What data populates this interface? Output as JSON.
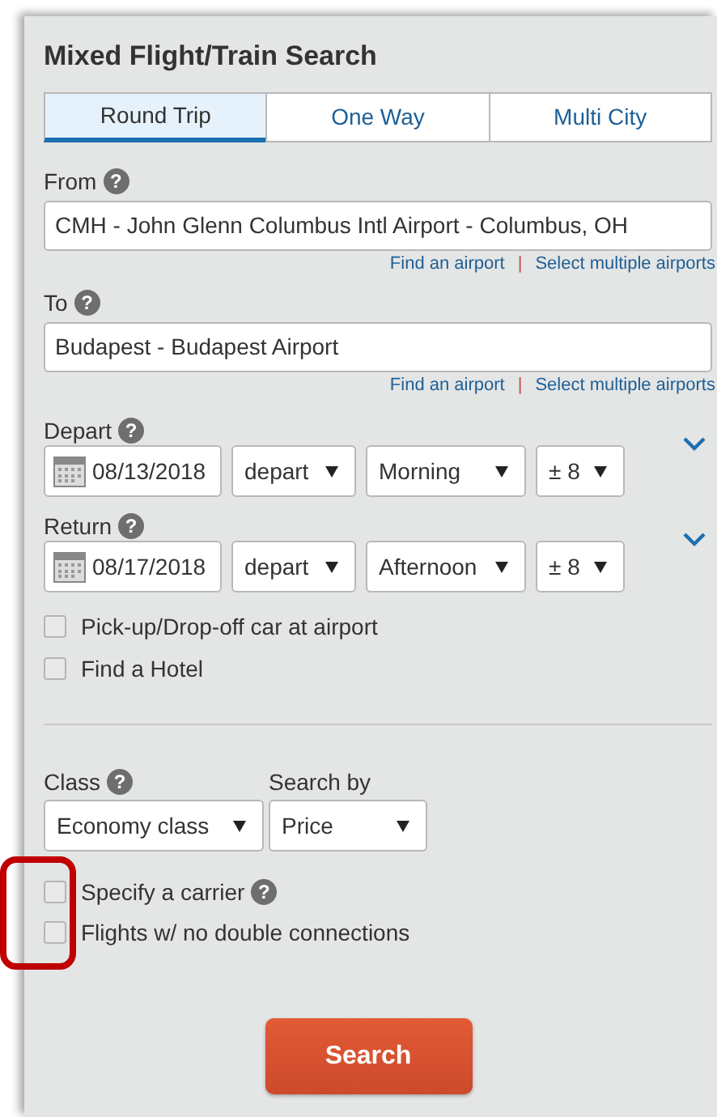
{
  "title": "Mixed Flight/Train Search",
  "tabs": [
    {
      "label": "Round Trip",
      "selected": true
    },
    {
      "label": "One Way",
      "selected": false
    },
    {
      "label": "Multi City",
      "selected": false
    }
  ],
  "places": [
    {
      "label": "From",
      "help": "?",
      "value": "CMH - John Glenn Columbus Intl Airport - Columbus, OH",
      "links": [
        "Find an airport",
        "Select multiple airports"
      ],
      "separator": "|"
    },
    {
      "label": "To",
      "help": "?",
      "value": "Budapest - Budapest Airport",
      "links": [
        "Find an airport",
        "Select multiple airports"
      ],
      "separator": "|"
    }
  ],
  "dates": [
    {
      "label": "Depart",
      "help": "?",
      "date": "08/13/2018",
      "mode": "depart",
      "time": "Morning",
      "range": "± 8",
      "expanded": false
    },
    {
      "label": "Return",
      "help": "?",
      "date": "08/17/2018",
      "mode": "depart",
      "time": "Afternoon",
      "range": "± 8",
      "expanded": false
    }
  ],
  "extras": [
    {
      "label": "Pick-up/Drop-off car at airport",
      "checked": false
    },
    {
      "label": "Find a Hotel",
      "checked": false
    }
  ],
  "class": {
    "label": "Class",
    "help": "?",
    "value": "Economy class"
  },
  "search_by": {
    "label": "Search by",
    "value": "Price"
  },
  "filters": [
    {
      "label": "Specify a carrier",
      "help": "?",
      "checked": false
    },
    {
      "label": "Flights w/ no double connections",
      "checked": false
    }
  ],
  "search_button": "Search"
}
